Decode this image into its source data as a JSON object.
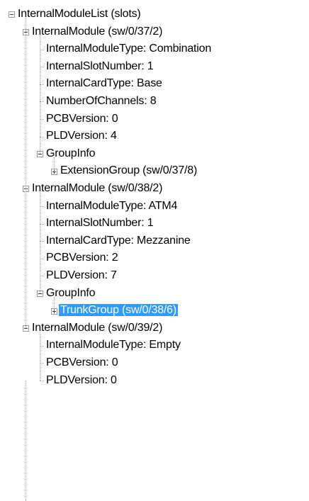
{
  "tree": {
    "root": {
      "label": "InternalModuleList (slots)",
      "expanded": true,
      "children": [
        {
          "label": "InternalModule (sw/0/37/2)",
          "expanded": true,
          "children": [
            {
              "label": "InternalModuleType: Combination"
            },
            {
              "label": "InternalSlotNumber: 1"
            },
            {
              "label": "InternalCardType: Base"
            },
            {
              "label": "NumberOfChannels: 8"
            },
            {
              "label": "PCBVersion: 0"
            },
            {
              "label": "PLDVersion: 4"
            },
            {
              "label": "GroupInfo",
              "expanded": true,
              "children": [
                {
                  "label": "ExtensionGroup (sw/0/37/8)",
                  "expanded": false,
                  "has_children": true
                }
              ]
            }
          ]
        },
        {
          "label": "InternalModule (sw/0/38/2)",
          "expanded": true,
          "children": [
            {
              "label": "InternalModuleType: ATM4"
            },
            {
              "label": "InternalSlotNumber: 1"
            },
            {
              "label": "InternalCardType: Mezzanine"
            },
            {
              "label": "PCBVersion: 2"
            },
            {
              "label": "PLDVersion: 7"
            },
            {
              "label": "GroupInfo",
              "expanded": true,
              "children": [
                {
                  "label": "TrunkGroup (sw/0/38/6)",
                  "expanded": false,
                  "has_children": true,
                  "selected": true
                }
              ]
            }
          ]
        },
        {
          "label": "InternalModule (sw/0/39/2)",
          "expanded": true,
          "children": [
            {
              "label": "InternalModuleType: Empty"
            },
            {
              "label": "PCBVersion: 0"
            },
            {
              "label": "PLDVersion: 0"
            }
          ]
        }
      ]
    }
  },
  "colors": {
    "selection_background": "#3399ff",
    "selection_text": "#ffffff",
    "connector_line": "#a0a0a0",
    "expander_border": "#9a9a9a"
  },
  "icons": {
    "expanded": "collapse-minus-icon",
    "collapsed": "expand-plus-icon"
  }
}
